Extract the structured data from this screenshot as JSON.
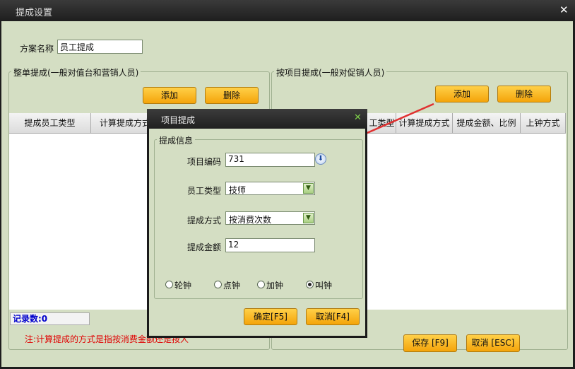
{
  "window": {
    "title": "提成设置",
    "close_glyph": "✕"
  },
  "scheme": {
    "label": "方案名称",
    "value": "员工提成"
  },
  "left_group": {
    "title": "整单提成(一般对值台和营销人员)",
    "add_label": "添加",
    "delete_label": "删除",
    "columns": [
      "提成员工类型",
      "计算提成方式"
    ],
    "record_label": "记录数:0"
  },
  "right_group": {
    "title": "按项目提成(一般对促销人员)",
    "add_label": "添加",
    "delete_label": "删除",
    "columns": [
      "工类型",
      "计算提成方式",
      "提成金额、比例",
      "上钟方式"
    ]
  },
  "note": "注:计算提成的方式是指按消费金额还是按人",
  "save_label": "保存 [F9]",
  "cancel_label": "取消 [ESC]",
  "dialog": {
    "title": "项目提成",
    "close_glyph": "✕",
    "group_title": "提成信息",
    "item_code": {
      "label": "项目编码",
      "value": "731"
    },
    "staff_type": {
      "label": "员工类型",
      "value": "技师"
    },
    "method": {
      "label": "提成方式",
      "value": "按消费次数"
    },
    "amount": {
      "label": "提成金额",
      "value": "12"
    },
    "radios": [
      {
        "label": "轮钟",
        "checked": false
      },
      {
        "label": "点钟",
        "checked": false
      },
      {
        "label": "加钟",
        "checked": false
      },
      {
        "label": "叫钟",
        "checked": true
      }
    ],
    "ok_label": "确定[F5]",
    "cancel_label": "取消[F4]"
  },
  "colors": {
    "accent_button": "#f4a40a",
    "background": "#d4dec3",
    "arrow": "#e03030",
    "note_text": "#e00000",
    "record_text": "#0000cc"
  }
}
